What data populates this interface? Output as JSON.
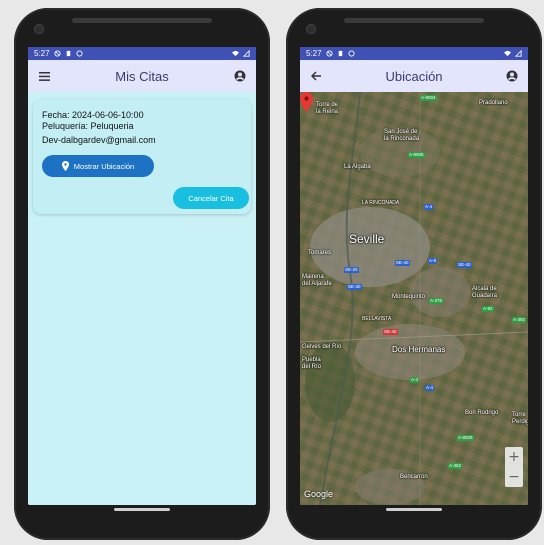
{
  "status": {
    "time": "5:27"
  },
  "left": {
    "title": "Mis Citas",
    "card": {
      "fecha": "Fecha: 2024-06-06-10:00",
      "peluqueria": "Peluquería: Peluqueria",
      "email": "Dev-dalbgardev@gmail.com",
      "location_button": "Mostrar Ubicación",
      "cancel_button": "Cancelar Cita"
    }
  },
  "right": {
    "title": "Ubicación",
    "map": {
      "labels": {
        "torre": "Torre de\nla Reina",
        "pradollano": "Pradollano",
        "sanjose": "San José de\nla Rinconada",
        "algaba": "La Algaba",
        "rinconada": "LA RINCONADA",
        "seville": "Seville",
        "tomares": "Tomares",
        "mairena": "Mairena\ndel Aljarafe",
        "montequinto": "Montequinto",
        "alcala": "Alcalá de\nGuadaíra",
        "bellavista": "BELLAVISTA",
        "doshermanas": "Dos Hermanas",
        "gelves": "Gelves del Río",
        "puebla": "Puebla\ndel Río",
        "bonrodrigo": "Bon Rodrigo",
        "torre_perdig": "Torre\nPerdig.",
        "bencarron": "Bencarrón"
      },
      "roads": [
        "A-8004",
        "A-8006",
        "SE-20",
        "SE-40",
        "A-4",
        "SE-30",
        "A-376",
        "A-392",
        "SE-40",
        "A-4",
        "A-8029",
        "A-362",
        "A-4",
        "A-8",
        "A-92",
        "SE-40"
      ],
      "google": "Google",
      "zoom_in": "+",
      "zoom_out": "−"
    }
  }
}
